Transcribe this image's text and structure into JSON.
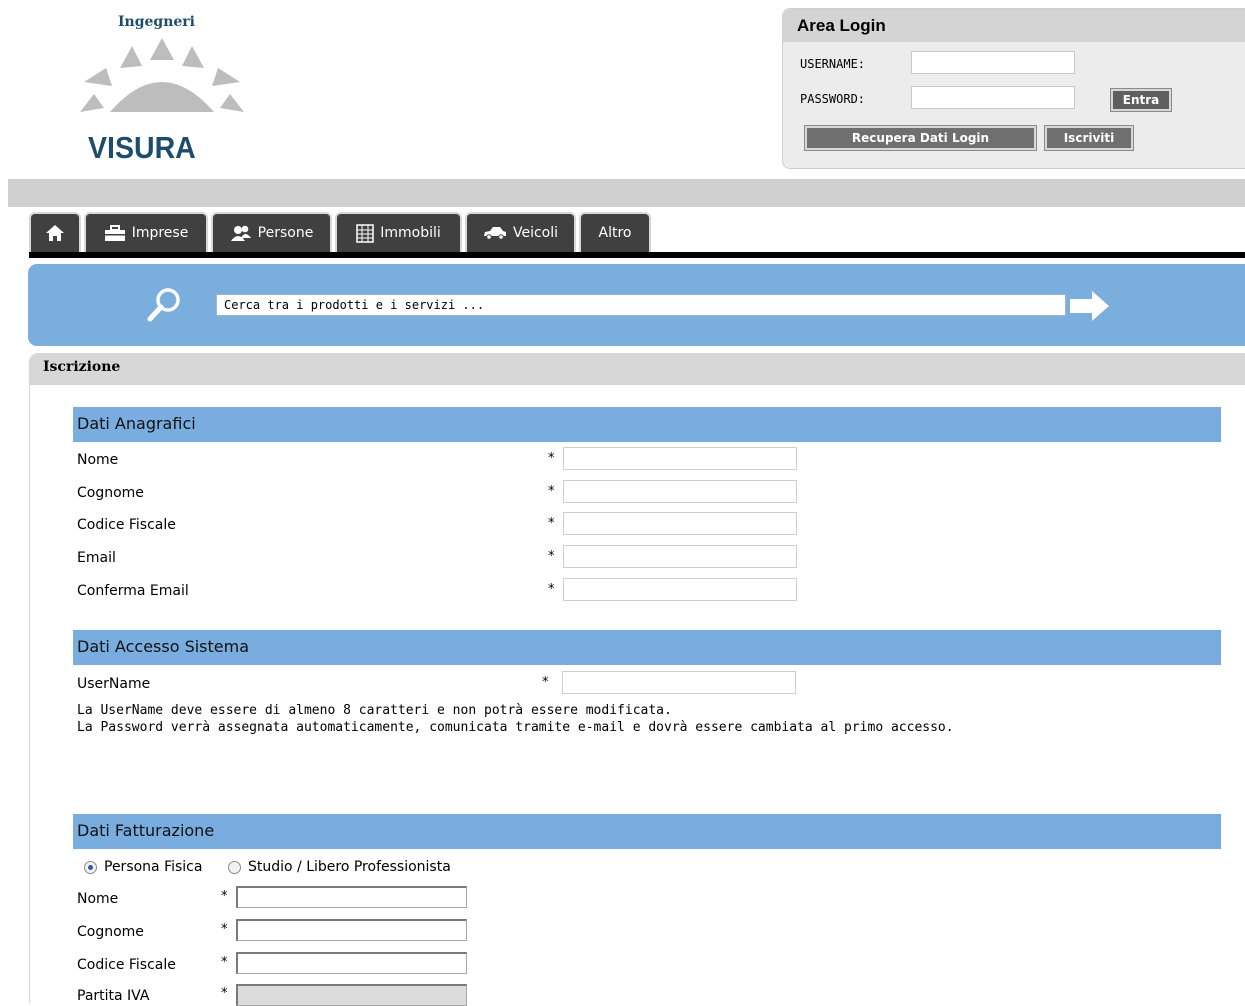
{
  "logo": {
    "top_text": "Ingegneri",
    "bottom_text": "VISURA"
  },
  "login": {
    "title": "Area Login",
    "username_label": "USERNAME:",
    "password_label": "PASSWORD:",
    "username_value": "",
    "password_value": "",
    "enter_button": "Entra",
    "recover_button": "Recupera Dati Login",
    "register_button": "Iscriviti"
  },
  "nav": {
    "tabs": [
      {
        "label": "",
        "icon": "home-icon"
      },
      {
        "label": "Imprese",
        "icon": "briefcase-icon"
      },
      {
        "label": "Persone",
        "icon": "people-icon"
      },
      {
        "label": "Immobili",
        "icon": "building-icon"
      },
      {
        "label": "Veicoli",
        "icon": "car-icon"
      },
      {
        "label": "Altro",
        "icon": ""
      }
    ]
  },
  "search": {
    "placeholder": "Cerca tra i prodotti e i servizi ...",
    "value": "Cerca tra i prodotti e i servizi ..."
  },
  "panel": {
    "title": "Iscrizione"
  },
  "anagrafici": {
    "title": "Dati Anagrafici",
    "fields": [
      "Nome",
      "Cognome",
      "Codice Fiscale",
      "Email",
      "Conferma Email"
    ],
    "required_mark": "*"
  },
  "accesso": {
    "title": "Dati Accesso Sistema",
    "username_label": "UserName",
    "note_1": "La UserName deve essere di almeno 8 caratteri e non potrà essere modificata.",
    "note_2": "La Password verrà assegnata automaticamente, comunicata tramite e-mail e dovrà essere cambiata al primo accesso."
  },
  "fatturazione": {
    "title": "Dati Fatturazione",
    "radio_options": [
      {
        "label": "Persona Fisica",
        "selected": true
      },
      {
        "label": "Studio / Libero Professionista",
        "selected": false
      }
    ],
    "fields": [
      "Nome",
      "Cognome",
      "Codice Fiscale",
      "Partita IVA"
    ]
  },
  "colors": {
    "accent_blue": "#7aaddf",
    "tab_dark": "#404040",
    "logo_blue": "#1e4d6b"
  }
}
